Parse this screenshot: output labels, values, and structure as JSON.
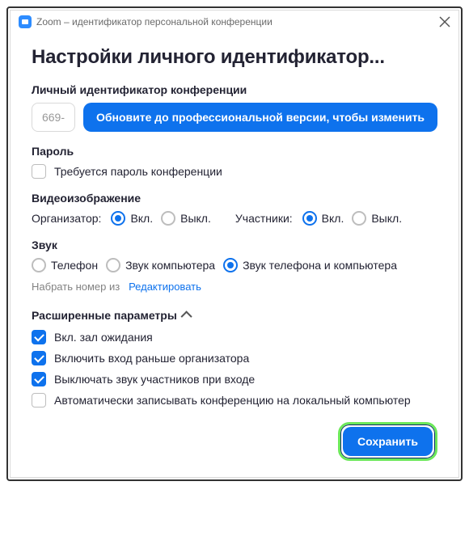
{
  "titlebar": {
    "text": "Zoom – идентификатор персональной конференции"
  },
  "page_title": "Настройки личного идентификатор...",
  "pmi": {
    "label": "Личный идентификатор конференции",
    "value": "669-",
    "upgrade_label": "Обновите до профессиональной версии, чтобы изменить"
  },
  "password": {
    "label": "Пароль",
    "require_label": "Требуется пароль конференции",
    "require_checked": false
  },
  "video": {
    "label": "Видеоизображение",
    "host_label": "Организатор:",
    "participants_label": "Участники:",
    "on_label": "Вкл.",
    "off_label": "Выкл.",
    "host_selected": "on",
    "participants_selected": "on"
  },
  "audio": {
    "label": "Звук",
    "telephone_label": "Телефон",
    "computer_label": "Звук компьютера",
    "both_label": "Звук телефона и компьютера",
    "selected": "both",
    "dial_from_label": "Набрать номер из",
    "edit_label": "Редактировать"
  },
  "advanced": {
    "label": "Расширенные параметры",
    "options": [
      {
        "label": "Вкл. зал ожидания",
        "checked": true
      },
      {
        "label": "Включить вход раньше организатора",
        "checked": true
      },
      {
        "label": "Выключать звук участников при входе",
        "checked": true
      },
      {
        "label": "Автоматически записывать конференцию на локальный компьютер",
        "checked": false
      }
    ]
  },
  "footer": {
    "save_label": "Сохранить"
  }
}
